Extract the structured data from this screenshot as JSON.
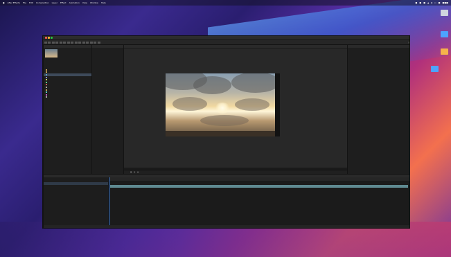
{
  "menubar": {
    "apple": "",
    "app": "After Effects",
    "items": [
      "File",
      "Edit",
      "Composition",
      "Layer",
      "Effect",
      "Animation",
      "View",
      "Window",
      "Help"
    ],
    "status": [
      "",
      "",
      "",
      "",
      "",
      "",
      "",
      ""
    ]
  },
  "desktop": {
    "icons": [
      {
        "label": "",
        "color": "#cfd6df"
      },
      {
        "label": "",
        "color": "#4da3ff"
      },
      {
        "label": "",
        "color": "#f6b24a"
      },
      {
        "label": "",
        "color": "#4da3ff"
      }
    ]
  },
  "window": {
    "title": "",
    "traffic_lights": [
      "#ff5f57",
      "#febc2e",
      "#28c840"
    ],
    "workspaces": [
      "",
      "",
      "",
      ""
    ]
  },
  "project_panel": {
    "tab": "",
    "meta": [
      "",
      "",
      ""
    ],
    "items": [
      "",
      "",
      "",
      "",
      "",
      "",
      "",
      "",
      "",
      "",
      "",
      ""
    ],
    "selected_index": 2,
    "swatch_colors": [
      "#c9a45a",
      "#c9a45a",
      "#5aa0c9",
      "#8a8ac9",
      "#c9c95a",
      "#5ac98a",
      "#c95a5a",
      "#aaaaaa",
      "#c9a45a",
      "#5ac9c9",
      "#c95ac9",
      "#aaaaaa"
    ]
  },
  "effects_panel": {
    "tab": "",
    "rows": [
      "",
      "",
      "",
      "",
      "",
      "",
      "",
      "",
      "",
      "",
      "",
      ""
    ]
  },
  "composition": {
    "tab": "",
    "footer": [
      "",
      "",
      "",
      "",
      "",
      ""
    ]
  },
  "properties_panel": {
    "tab": "",
    "rows": [
      "",
      "",
      "",
      "",
      "",
      "",
      "",
      "",
      "",
      "",
      "",
      "",
      "",
      ""
    ]
  },
  "timeline": {
    "tab": "",
    "rows": [
      "",
      "",
      "",
      ""
    ],
    "footer": ""
  }
}
